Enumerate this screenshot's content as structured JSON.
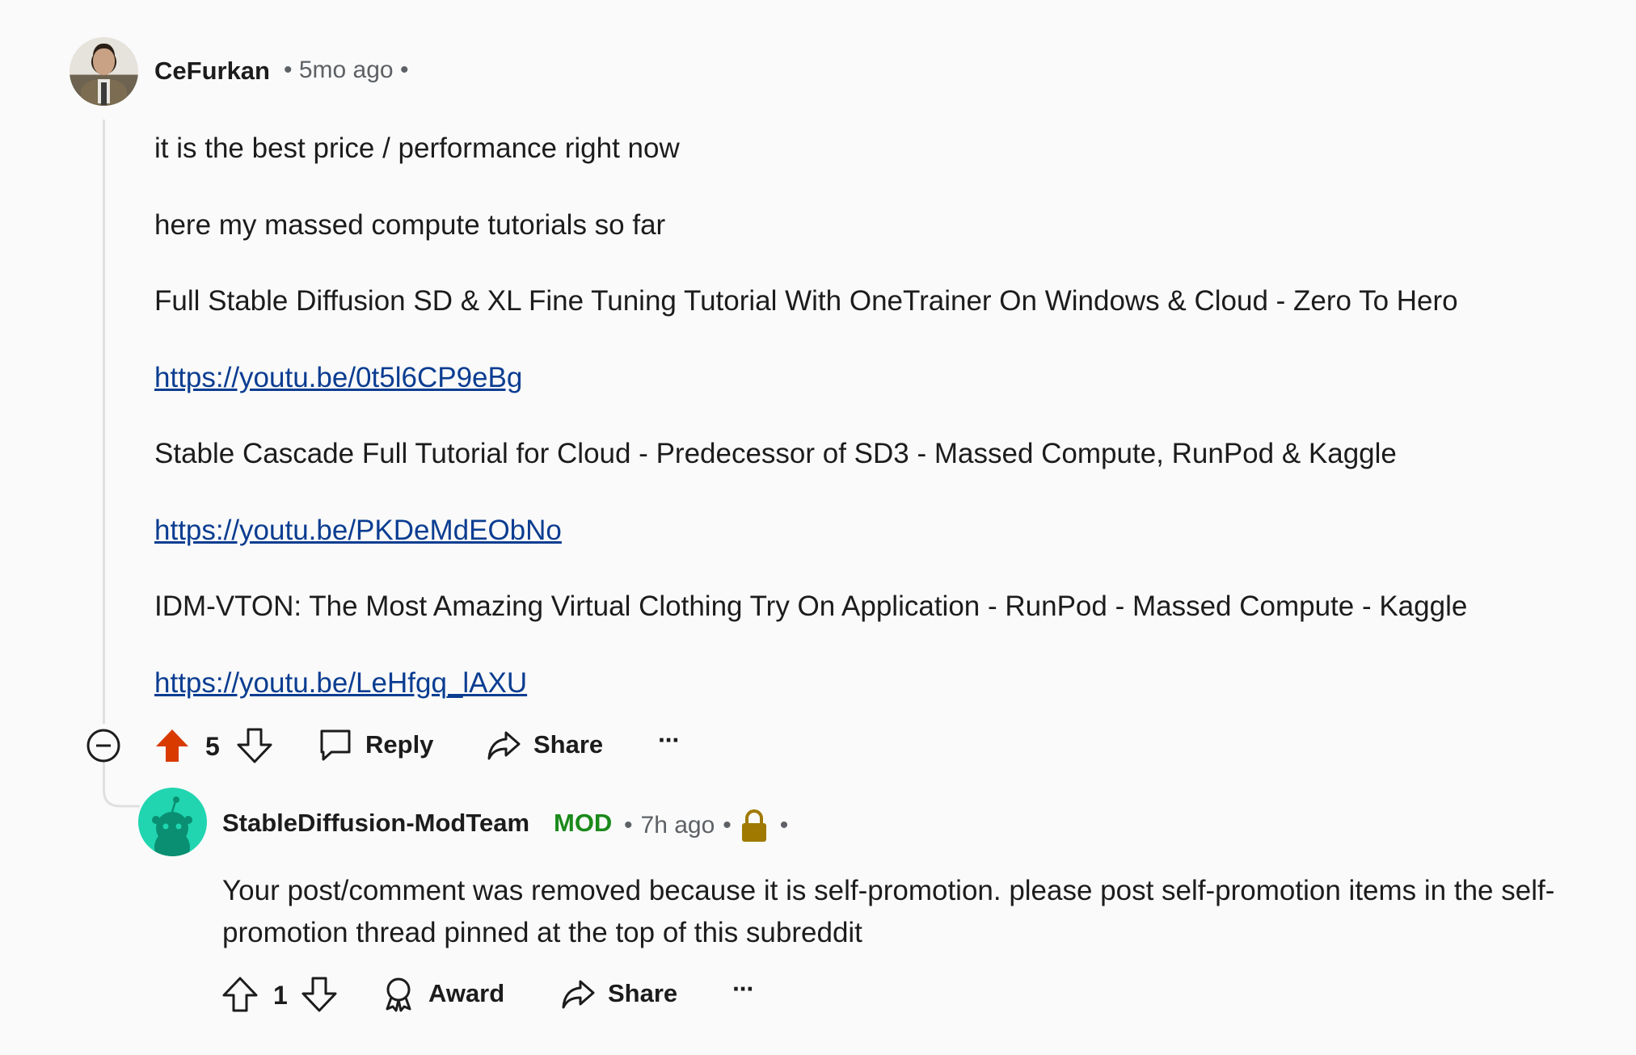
{
  "comment": {
    "username": "CeFurkan",
    "age": "5mo ago",
    "paragraphs": [
      "it is the best price / performance right now",
      "here my massed compute tutorials so far"
    ],
    "tutorials": [
      {
        "title": "Full Stable Diffusion SD & XL Fine Tuning Tutorial With OneTrainer On Windows & Cloud - Zero To Hero",
        "url": "https://youtu.be/0t5l6CP9eBg"
      },
      {
        "title": "Stable Cascade Full Tutorial for Cloud - Predecessor of SD3 - Massed Compute, RunPod & Kaggle",
        "url": "https://youtu.be/PKDeMdEObNo"
      },
      {
        "title": "IDM-VTON: The Most Amazing Virtual Clothing Try On Application - RunPod - Massed Compute - Kaggle",
        "url": "https://youtu.be/LeHfgq_lAXU"
      }
    ],
    "vote_count": "5",
    "reply_label": "Reply",
    "share_label": "Share",
    "more_label": "···"
  },
  "reply": {
    "username": "StableDiffusion-ModTeam",
    "mod_badge": "MOD",
    "age": "7h ago",
    "text_line1": "Your post/comment was removed because it is self-promotion. please post self-promotion items in the self-",
    "text_line2": "promotion thread pinned at the top of this subreddit",
    "vote_count": "1",
    "award_label": "Award",
    "share_label": "Share",
    "more_label": "···"
  },
  "colors": {
    "upvote_active": "#d93a00",
    "mod_green": "#1a8a1a",
    "link": "#0b3d91",
    "lock": "#a07a00",
    "mod_avatar": "#20d5b0"
  },
  "icons": [
    "collapse-icon",
    "upvote-icon",
    "downvote-icon",
    "comment-icon",
    "share-icon",
    "more-icon",
    "lock-icon",
    "award-icon"
  ]
}
